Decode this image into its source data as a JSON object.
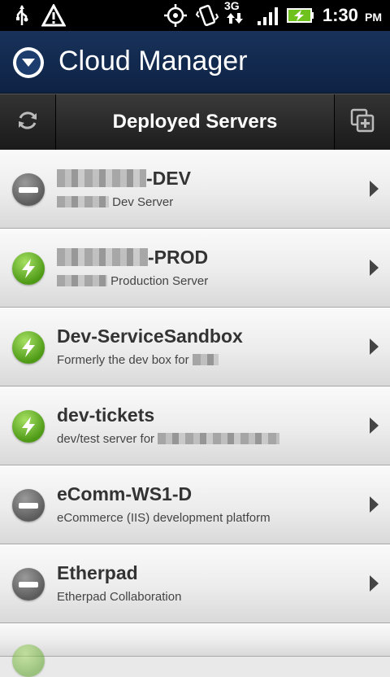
{
  "status_bar": {
    "time": "1:30",
    "ampm": "PM",
    "network": "3G",
    "icons": [
      "usb-icon",
      "warning-icon",
      "gps-icon",
      "vibrate-icon",
      "network-3g-icon",
      "signal-icon",
      "battery-charging-icon"
    ]
  },
  "app": {
    "title": "Cloud Manager",
    "logo_icon": "chevron-down-circle-icon"
  },
  "toolbar": {
    "title": "Deployed Servers",
    "refresh_icon": "refresh-icon",
    "add_icon": "add-server-icon"
  },
  "servers": [
    {
      "status": "stopped",
      "name_suffix": "-DEV",
      "desc_suffix": "Dev Server"
    },
    {
      "status": "running",
      "name_suffix": "-PROD",
      "desc_suffix": "Production Server"
    },
    {
      "status": "running",
      "name": "Dev-ServiceSandbox",
      "desc": "Formerly the dev box for"
    },
    {
      "status": "running",
      "name": "dev-tickets",
      "desc": "dev/test server for"
    },
    {
      "status": "stopped",
      "name": "eComm-WS1-D",
      "desc": "eCommerce (IIS) development platform"
    },
    {
      "status": "stopped",
      "name": "Etherpad",
      "desc": "Etherpad Collaboration"
    }
  ],
  "colors": {
    "title_bar": "#18325a",
    "running": "#5aa61f",
    "stopped": "#6b6b6b"
  }
}
